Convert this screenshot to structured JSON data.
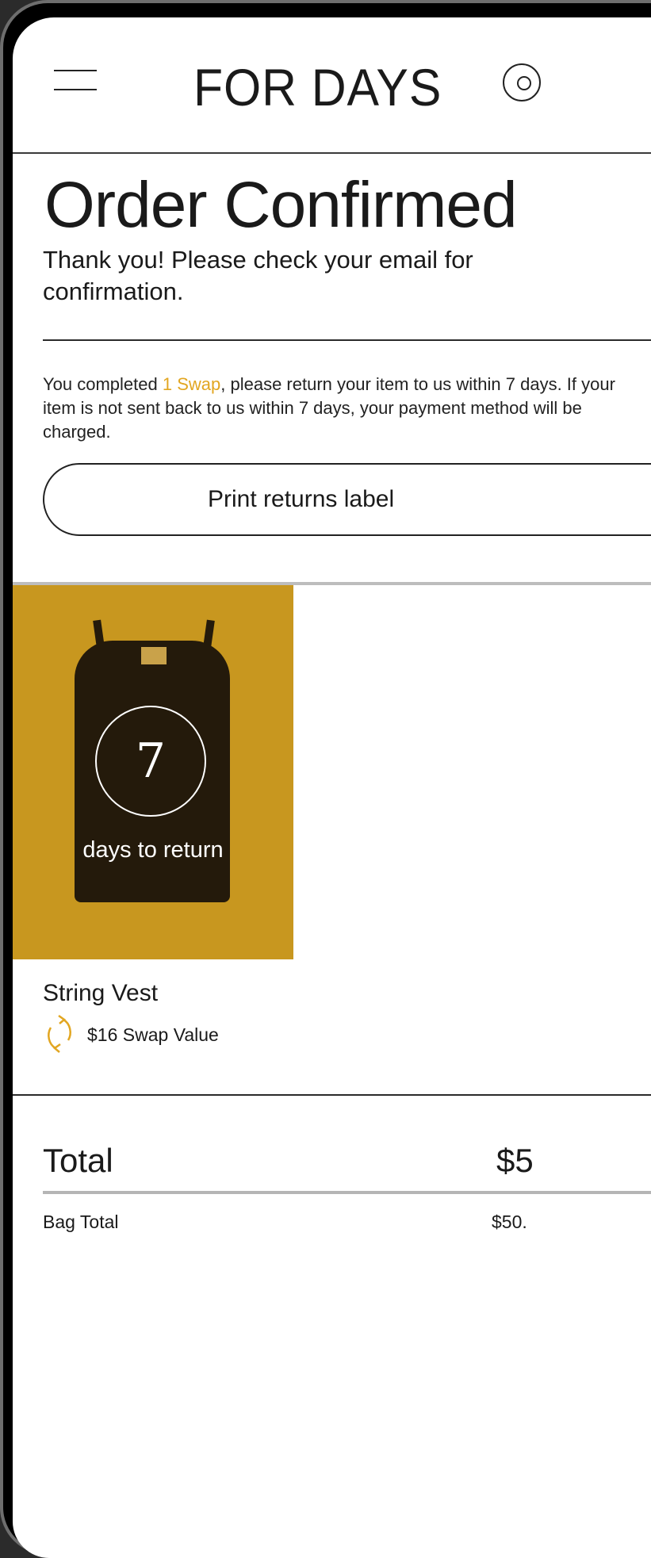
{
  "header": {
    "brand": "FOR DAYS"
  },
  "order": {
    "title": "Order Confirmed",
    "subtitle": "Thank you! Please check your email for confirmation.",
    "notice_prefix": "You completed ",
    "notice_highlight": "1 Swap",
    "notice_suffix": ", please return your item to us within 7 days. If your item is not sent back to us within 7 days, your payment method will be charged.",
    "print_label": "Print returns label"
  },
  "product": {
    "days_number": "7",
    "days_text": "days to return",
    "name": "String Vest",
    "swap_value": "$16 Swap Value"
  },
  "totals": {
    "total_label": "Total",
    "total_value": "$5",
    "bag_total_label": "Bag Total",
    "bag_total_value": "$50."
  },
  "colors": {
    "accent": "#e2a621",
    "image_background": "#c8971f"
  }
}
